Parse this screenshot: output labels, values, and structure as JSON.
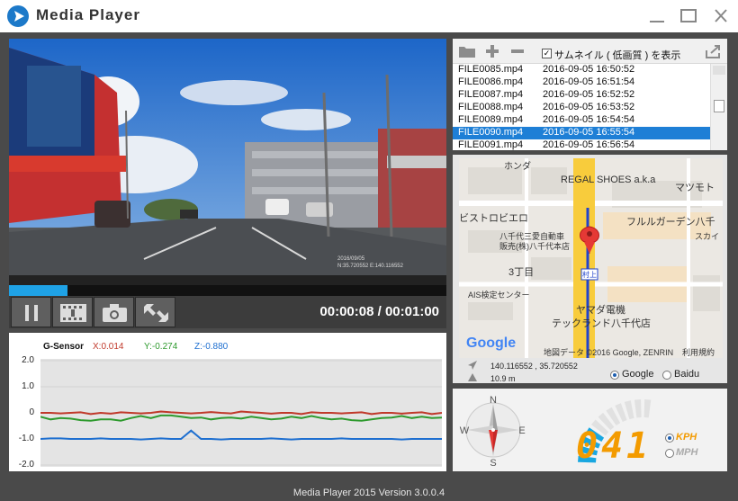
{
  "window": {
    "title": "Media Player"
  },
  "player": {
    "time_current": "00:00:08",
    "time_separator": "/",
    "time_total": "00:01:00",
    "progress_fraction": 0.133,
    "buttons": [
      "pause-icon",
      "film-strip-icon",
      "camera-icon",
      "fullscreen-icon"
    ],
    "overlay_date": "2016/09/05",
    "overlay_coords": "N:35.720552 E:140.116552"
  },
  "filelist": {
    "thumbnail_label": "サムネイル ( 低画質 ) を表示",
    "thumbnail_checked": true,
    "rows": [
      {
        "name": "FILE0085.mp4",
        "date": "2016-09-05 16:50:52"
      },
      {
        "name": "FILE0086.mp4",
        "date": "2016-09-05 16:51:54"
      },
      {
        "name": "FILE0087.mp4",
        "date": "2016-09-05 16:52:52"
      },
      {
        "name": "FILE0088.mp4",
        "date": "2016-09-05 16:53:52"
      },
      {
        "name": "FILE0089.mp4",
        "date": "2016-09-05 16:54:54"
      },
      {
        "name": "FILE0090.mp4",
        "date": "2016-09-05 16:55:54",
        "selected": true
      },
      {
        "name": "FILE0091.mp4",
        "date": "2016-09-05 16:56:54"
      }
    ]
  },
  "map": {
    "labels": {
      "shop_top": "ホンダ",
      "regal": "REGAL SHOES a.k.a",
      "matsumoto": "マツモト",
      "bistro": "ビストロビエロ",
      "flower": "フルルガーデン八千",
      "sky": "スカイ",
      "sanmitsu1": "八千代三愛自動車",
      "sanmitsu2": "販売(株)八千代本店",
      "chome": "3丁目",
      "ais": "AIS検定センター",
      "yamada1": "ヤマダ電機",
      "yamada2": "テックランド八千代店",
      "station": "村上",
      "google": "Google",
      "attribution": "地図データ ©2016 Google, ZENRIN",
      "terms": "利用規約"
    },
    "coords": "140.116552 , 35.720552",
    "altitude": "10.9 m",
    "providers": [
      {
        "label": "Google",
        "selected": true
      },
      {
        "label": "Baidu",
        "selected": false
      }
    ]
  },
  "compass": {
    "n": "N",
    "e": "E",
    "s": "S",
    "w": "W"
  },
  "speed": {
    "value": "041",
    "units": [
      {
        "label": "KPH",
        "selected": true
      },
      {
        "label": "MPH",
        "selected": false
      }
    ]
  },
  "gsensor": {
    "title": "G-Sensor",
    "x": {
      "label": "X:0.014",
      "color": "#c0392b"
    },
    "y": {
      "label": "Y:-0.274",
      "color": "#2e9a2e"
    },
    "z": {
      "label": "Z:-0.880",
      "color": "#1e6fd0"
    },
    "yticks": [
      "2.0",
      "1.0",
      "0",
      "-1.0",
      "-2.0"
    ]
  },
  "chart_data": {
    "type": "line",
    "title": "G-Sensor",
    "ylim": [
      -2.0,
      2.0
    ],
    "yticks": [
      2.0,
      1.0,
      0,
      -1.0,
      -2.0
    ],
    "x": [
      0,
      1,
      2,
      3,
      4,
      5,
      6,
      7,
      8,
      9,
      10,
      11,
      12,
      13,
      14,
      15,
      16,
      17,
      18,
      19,
      20,
      21,
      22,
      23,
      24,
      25,
      26,
      27,
      28,
      29,
      30,
      31,
      32,
      33,
      34,
      35,
      36,
      37,
      38,
      39,
      40
    ],
    "series": [
      {
        "name": "X:0.014",
        "color": "#c0392b",
        "values": [
          0.0,
          0.0,
          -0.02,
          0.0,
          0.02,
          -0.05,
          0.0,
          -0.03,
          0.02,
          0.0,
          -0.02,
          0.0,
          0.05,
          0.02,
          0.0,
          -0.02,
          0.0,
          0.03,
          0.0,
          -0.02,
          0.05,
          0.02,
          0.0,
          -0.03,
          0.0,
          0.0,
          -0.05,
          0.02,
          0.0,
          0.0,
          -0.02,
          0.0,
          0.02,
          -0.05,
          0.0,
          0.0,
          -0.03,
          0.0,
          0.02,
          -0.05,
          0.0
        ]
      },
      {
        "name": "Y:-0.274",
        "color": "#2e9a2e",
        "values": [
          -0.15,
          -0.25,
          -0.2,
          -0.22,
          -0.28,
          -0.3,
          -0.25,
          -0.25,
          -0.3,
          -0.2,
          -0.12,
          -0.2,
          -0.1,
          -0.1,
          -0.15,
          -0.2,
          -0.18,
          -0.25,
          -0.2,
          -0.18,
          -0.22,
          -0.15,
          -0.2,
          -0.25,
          -0.22,
          -0.15,
          -0.2,
          -0.12,
          -0.2,
          -0.25,
          -0.22,
          -0.28,
          -0.3,
          -0.25,
          -0.2,
          -0.18,
          -0.12,
          -0.2,
          -0.15,
          -0.2,
          -0.18
        ]
      },
      {
        "name": "Z:-0.880",
        "color": "#1e6fd0",
        "values": [
          -1.0,
          -0.98,
          -0.98,
          -1.0,
          -1.0,
          -1.0,
          -0.98,
          -1.0,
          -1.0,
          -1.0,
          -1.02,
          -1.0,
          -0.98,
          -1.0,
          -1.0,
          -0.68,
          -1.0,
          -1.0,
          -1.02,
          -1.0,
          -1.0,
          -1.0,
          -1.0,
          -0.98,
          -1.0,
          -1.02,
          -1.0,
          -1.0,
          -1.0,
          -1.0,
          -0.98,
          -1.0,
          -1.0,
          -1.0,
          -1.0,
          -1.0,
          -1.02,
          -1.0,
          -1.0,
          -1.0,
          -1.0
        ]
      }
    ]
  },
  "status": {
    "text": "Media Player 2015 Version 3.0.0.4"
  }
}
